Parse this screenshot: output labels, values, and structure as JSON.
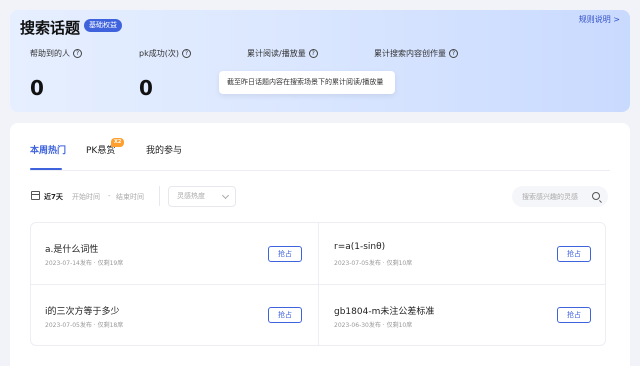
{
  "header": {
    "title": "搜索话题",
    "badge": "基础权益",
    "rules_link": "规则说明 >"
  },
  "stats": [
    {
      "label": "帮助到的人",
      "value": "0"
    },
    {
      "label": "pk成功(次)",
      "value": "0"
    },
    {
      "label": "累计阅读/播放量",
      "value": ""
    },
    {
      "label": "累计搜索内容创作量",
      "value": ""
    }
  ],
  "tooltip": "截至昨日话题内容在搜索场景下的累计阅读/播放量",
  "tabs": [
    {
      "label": "本周热门"
    },
    {
      "label": "PK悬赏",
      "badge": "X2"
    },
    {
      "label": "我的参与"
    }
  ],
  "filters": {
    "range_label": "近7天",
    "start_placeholder": "开始时间",
    "separator": "-",
    "end_placeholder": "结束时间",
    "heat_placeholder": "灵感热度",
    "search_placeholder": "搜索感兴趣的灵感"
  },
  "topics": [
    {
      "title": "a.是什么词性",
      "meta": "2023-07-14发布 · 仅剩19席",
      "action": "抢占"
    },
    {
      "title": "r=a(1-sinθ)",
      "meta": "2023-07-05发布 · 仅剩10席",
      "action": "抢占"
    },
    {
      "title": "i的三次方等于多少",
      "meta": "2023-07-05发布 · 仅剩18席",
      "action": "抢占"
    },
    {
      "title": "gb1804-m未注公差标准",
      "meta": "2023-06-30发布 · 仅剩10席",
      "action": "抢占"
    }
  ],
  "colors": {
    "accent": "#3e63dd",
    "badge_orange": "#ff9f2e"
  }
}
